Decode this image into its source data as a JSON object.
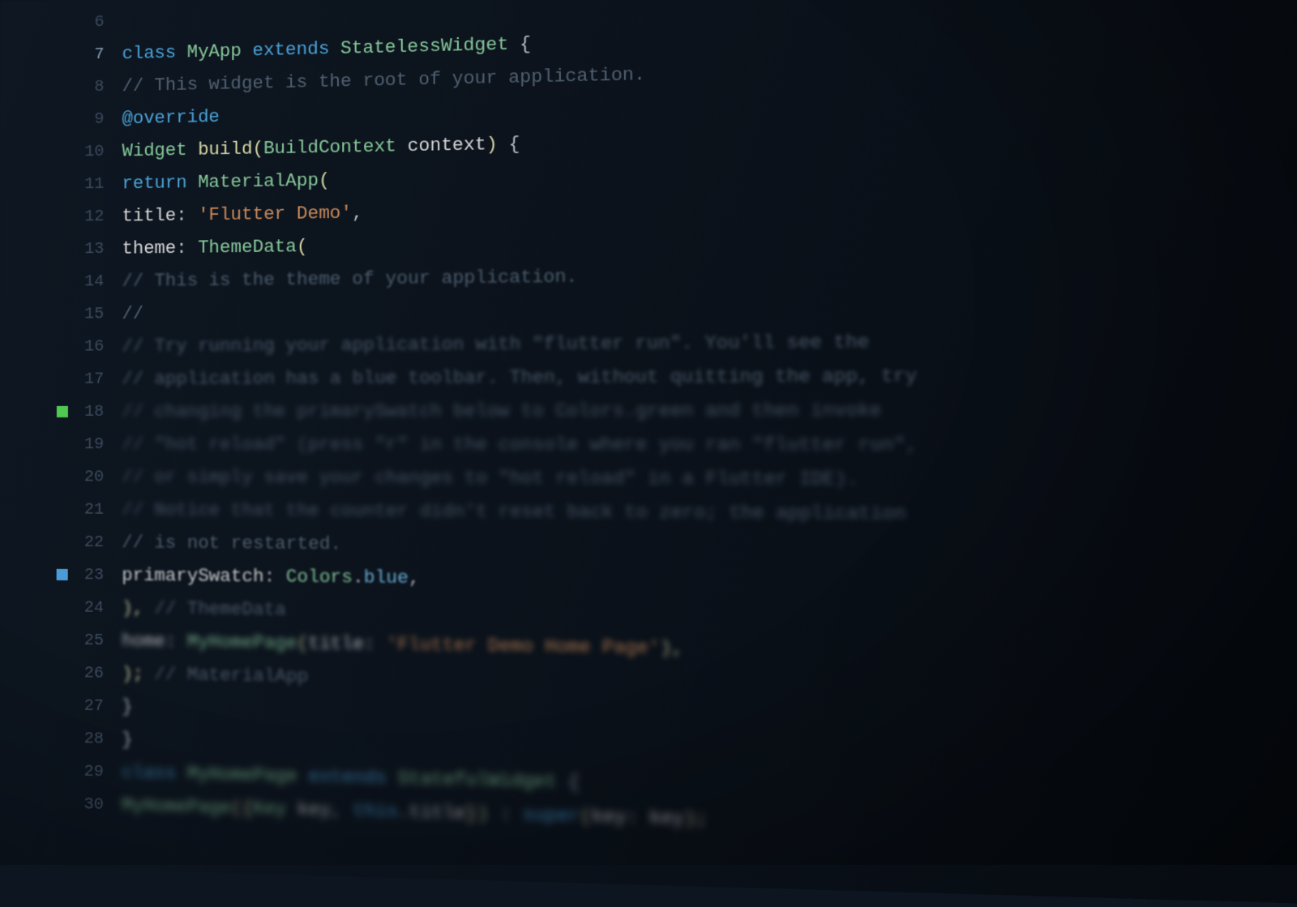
{
  "gutter": {
    "line_numbers": [
      "6",
      "7",
      "8",
      "9",
      "10",
      "11",
      "12",
      "13",
      "14",
      "15",
      "16",
      "17",
      "18",
      "19",
      "20",
      "21",
      "22",
      "23",
      "24",
      "25",
      "26",
      "27",
      "28",
      "29",
      "30"
    ],
    "markers": {
      "18": "green",
      "23": "blue"
    }
  },
  "code": {
    "l6": "",
    "l7": {
      "kw_class": "class ",
      "name": "MyApp ",
      "kw_extends": "extends ",
      "base": "StatelessWidget ",
      "brace": "{"
    },
    "l8": {
      "comment": "// This widget is the root of your application."
    },
    "l9": {
      "decorator": "@override"
    },
    "l10": {
      "type": "Widget ",
      "method": "build",
      "open": "(",
      "ptype": "BuildContext ",
      "pname": "context",
      "close": ") ",
      "brace": "{"
    },
    "l11": {
      "kw_return": "return ",
      "ctor": "MaterialApp",
      "open": "("
    },
    "l12": {
      "prop": "title",
      "colon": ": ",
      "str": "'Flutter Demo'",
      "comma": ","
    },
    "l13": {
      "prop": "theme",
      "colon": ": ",
      "ctor": "ThemeData",
      "open": "("
    },
    "l14": {
      "comment": "// This is the theme of your application."
    },
    "l15": {
      "comment": "//"
    },
    "l16": {
      "comment": "// Try running your application with \"flutter run\". You'll see the"
    },
    "l17": {
      "comment": "// application has a blue toolbar. Then, without quitting the app, try"
    },
    "l18": {
      "comment": "// changing the primarySwatch below to Colors.green and then invoke"
    },
    "l19": {
      "comment": "// \"hot reload\" (press \"r\" in the console where you ran \"flutter run\","
    },
    "l20": {
      "comment": "// or simply save your changes to \"hot reload\" in a Flutter IDE)."
    },
    "l21": {
      "comment": "// Notice that the counter didn't reset back to zero; the application"
    },
    "l22": {
      "comment": "// is not restarted."
    },
    "l23": {
      "prop": "primarySwatch",
      "colon": ": ",
      "cls": "Colors",
      "dot": ".",
      "member": "blue",
      "comma": ","
    },
    "l24": {
      "close": "), ",
      "comment": "// ThemeData"
    },
    "l25": {
      "prop": "home",
      "colon": ": ",
      "ctor": "MyHomePage",
      "open": "(",
      "p1": "title",
      "pcolon": ": ",
      "str": "'Flutter Demo Home Page'",
      "close": "),"
    },
    "l26": {
      "close": "); ",
      "comment": "// MaterialApp"
    },
    "l27": {
      "brace": "}"
    },
    "l28": {
      "brace": "}"
    },
    "l29": {
      "kw_class": "class ",
      "name": "MyHomePage ",
      "kw_extends": "extends ",
      "base": "StatefulWidget ",
      "brace": "{"
    },
    "l30": {
      "ctor": "MyHomePage",
      "open": "({",
      "ptype": "Key ",
      "pname": "key",
      "comma": ", ",
      "kw_this": "this",
      "dot": ".",
      "field": "title",
      "close": "}) ",
      "colon": ": ",
      "super": "super",
      "sopen": "(",
      "skey": "key",
      "scolon": ": ",
      "sval": "key",
      "sclose": ");"
    }
  }
}
